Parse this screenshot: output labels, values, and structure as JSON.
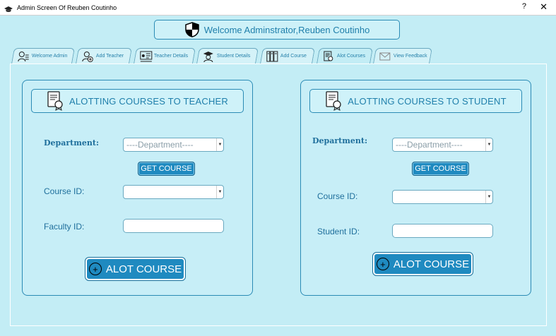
{
  "window": {
    "title": "Admin Screen Of Reuben Coutinho",
    "help_label": "?",
    "close_label": "✕"
  },
  "welcome": {
    "text": "Welcome Adminstrator,Reuben Coutinho"
  },
  "tabs": [
    {
      "label": "Welcome Admin",
      "icon": "admin-icon"
    },
    {
      "label": "Add Teacher",
      "icon": "add-teacher-icon"
    },
    {
      "label": "Teacher Details",
      "icon": "teacher-details-icon"
    },
    {
      "label": "Student Details",
      "icon": "student-details-icon"
    },
    {
      "label": "Add Course",
      "icon": "books-icon"
    },
    {
      "label": "Alot Courses",
      "icon": "certificate-icon",
      "active": true
    },
    {
      "label": "View Feedback",
      "icon": "feedback-icon"
    }
  ],
  "teacher_panel": {
    "heading": "ALOTTING COURSES TO TEACHER",
    "department_label": "Department:",
    "department_value": "----Department----",
    "get_course_label": "GET COURSE",
    "course_label": "Course ID:",
    "course_value": "",
    "id_label": "Faculty ID:",
    "id_value": "",
    "alot_label": "ALOT COURSE"
  },
  "student_panel": {
    "heading": "ALOTTING COURSES TO STUDENT",
    "department_label": "Department:",
    "department_value": "----Department----",
    "get_course_label": "GET COURSE",
    "course_label": "Course ID:",
    "course_value": "",
    "id_label": "Student ID:",
    "id_value": "",
    "alot_label": "ALOT COURSE"
  },
  "colors": {
    "background": "#c3edf5",
    "accent": "#1f8ac0",
    "text": "#1f7fab"
  }
}
